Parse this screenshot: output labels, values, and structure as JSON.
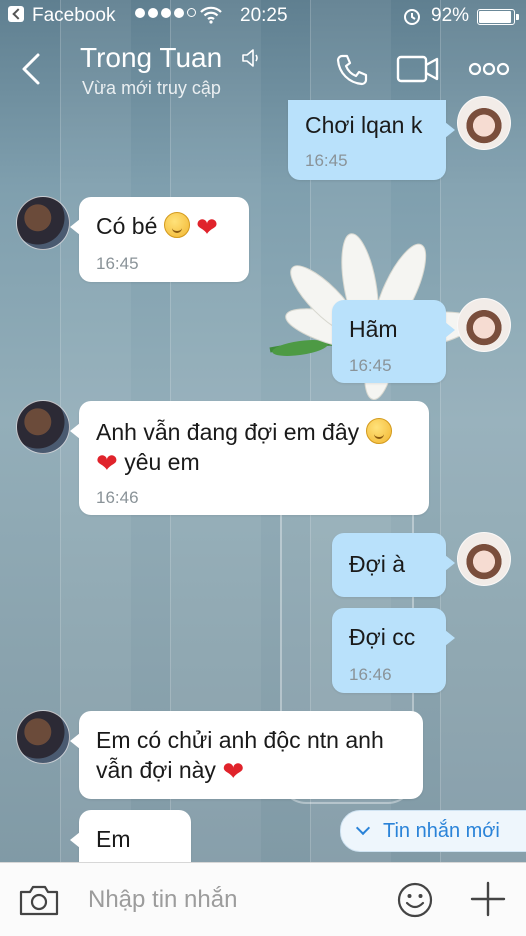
{
  "status_bar": {
    "app": "Facebook",
    "time": "20:25",
    "battery": "92%"
  },
  "header": {
    "name": "Trong Tuan",
    "subtitle": "Vừa mới truy cập"
  },
  "messages": [
    {
      "from": "me",
      "text": "Chơi lqan k",
      "time": "16:45"
    },
    {
      "from": "them",
      "text": "Có bé",
      "emoji": [
        "smile-emoji",
        "heart-emoji"
      ],
      "time": "16:45"
    },
    {
      "from": "me",
      "text": "Hãm",
      "time": "16:45"
    },
    {
      "from": "them",
      "line1": "Anh vẫn đang đợi em đây",
      "line2": "yêu em",
      "time": "16:46"
    },
    {
      "from": "me",
      "text": "Đợi à"
    },
    {
      "from": "me",
      "text": "Đợi cc",
      "time": "16:46"
    },
    {
      "from": "them",
      "line1": "Em có chửi anh độc ntn anh",
      "line2": "vẫn đợi này"
    },
    {
      "from": "them",
      "text": "Em"
    }
  ],
  "new_messages_label": "Tin nhắn mới",
  "composer": {
    "placeholder": "Nhập tin nhắn"
  },
  "colors": {
    "outgoing_bubble": "#b9e1fb",
    "incoming_bubble": "#ffffff",
    "accent": "#2a83d8",
    "heart": "#e0232b"
  },
  "icons": [
    "back-icon",
    "mute-icon",
    "phone-icon",
    "video-call-icon",
    "more-icon",
    "camera-icon",
    "emoji-icon",
    "plus-icon",
    "chevron-down-icon"
  ]
}
